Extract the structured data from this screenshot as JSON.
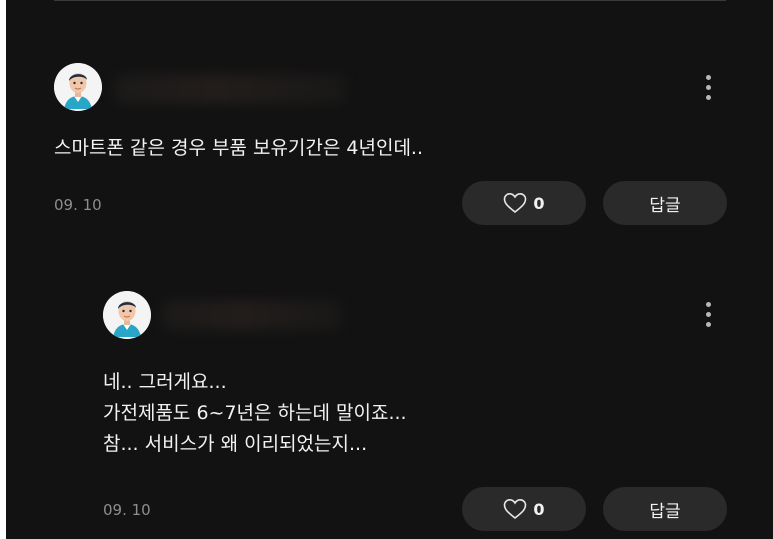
{
  "comments": [
    {
      "text_lines": [
        "스마트폰 같은 경우 부품 보유기간은 4년인데.."
      ],
      "date": "09. 10",
      "likes": "0",
      "reply_label": "답글",
      "avatar_icon": "user-avatar-icon",
      "menu_icon": "more-vertical-icon",
      "like_icon": "heart-outline-icon"
    },
    {
      "text_lines": [
        "네.. 그러게요...",
        "가전제품도 6~7년은 하는데 말이죠...",
        "참... 서비스가 왜 이리되었는지..."
      ],
      "date": "09. 10",
      "likes": "0",
      "reply_label": "답글",
      "avatar_icon": "user-avatar-icon",
      "menu_icon": "more-vertical-icon",
      "like_icon": "heart-outline-icon"
    }
  ],
  "colors": {
    "background": "#121212",
    "pill_background": "#2a2a2a",
    "text_primary": "#f2f2f2",
    "text_secondary": "#8e8e8e",
    "avatar_shirt": "#29a5c8"
  }
}
